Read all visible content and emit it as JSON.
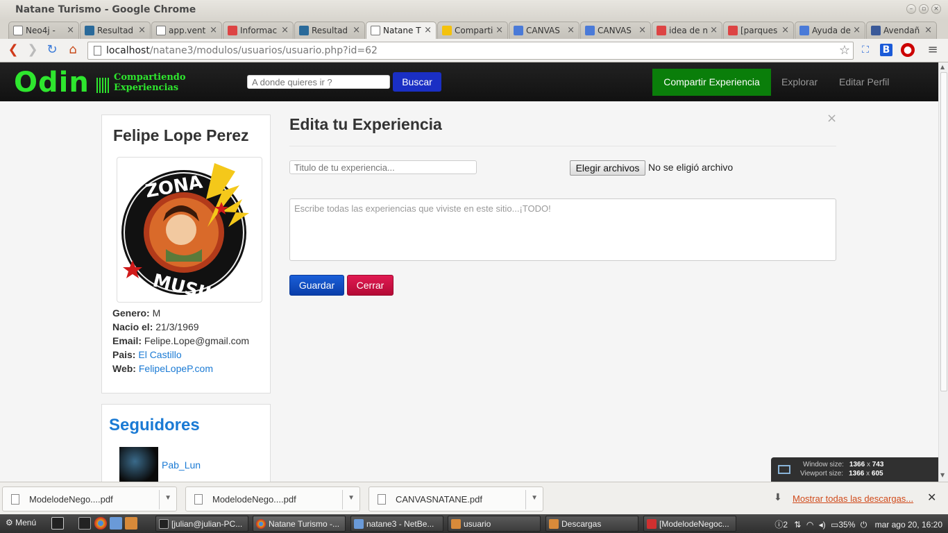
{
  "window": {
    "title": "Natane Turismo - Google Chrome"
  },
  "tabs": [
    {
      "label": "Neo4j - ",
      "icon": "doc-icon",
      "color": "#ffffff"
    },
    {
      "label": "Resultad",
      "icon": "bitnami-icon",
      "color": "#2a6a9a"
    },
    {
      "label": "app.vent",
      "icon": "doc-icon",
      "color": "#ffffff"
    },
    {
      "label": "Informac",
      "icon": "gmail-icon",
      "color": "#d44"
    },
    {
      "label": "Resultad",
      "icon": "bitnami-icon",
      "color": "#2a6a9a"
    },
    {
      "label": "Natane T",
      "icon": "doc-icon",
      "color": "#ffffff",
      "active": true
    },
    {
      "label": "Comparti",
      "icon": "drive-icon",
      "color": "#f4c20d"
    },
    {
      "label": "CANVAS",
      "icon": "docs-icon",
      "color": "#4a7ad8"
    },
    {
      "label": "CANVAS",
      "icon": "docs-icon",
      "color": "#4a7ad8"
    },
    {
      "label": "idea de n",
      "icon": "gmail-icon",
      "color": "#d44"
    },
    {
      "label": "[parques",
      "icon": "gmail-icon",
      "color": "#d44"
    },
    {
      "label": "Ayuda de",
      "icon": "google-icon",
      "color": "#4a7ad8"
    },
    {
      "label": "Avendañ",
      "icon": "facebook-icon",
      "color": "#3b5998"
    }
  ],
  "address": {
    "host": "localhost",
    "path": "/natane3/modulos/usuarios/usuario.php?id=62"
  },
  "site": {
    "brand": "Odin",
    "brand_sub_1": "Compartiendo",
    "brand_sub_2": "Experiencias",
    "search_placeholder": "A donde quieres ir ?",
    "search_button": "Buscar",
    "nav_share": "Compartir Experiencia",
    "nav_explore": "Explorar",
    "nav_edit": "Editar Perfil"
  },
  "profile": {
    "name": "Felipe Lope Perez",
    "avatar_text_top": "ZONA",
    "avatar_text_bottom": "MUSIK",
    "gender_label": "Genero:",
    "gender": "M",
    "born_label": "Nacio el:",
    "born": "21/3/1969",
    "email_label": "Email:",
    "email": "Felipe.Lope@gmail.com",
    "country_label": "Pais:",
    "country": "El Castillo",
    "web_label": "Web:",
    "web": "FelipeLopeP.com"
  },
  "followers": {
    "title": "Seguidores",
    "items": [
      {
        "name": "Pab_Lun"
      }
    ]
  },
  "edit": {
    "title": "Edita tu Experiencia",
    "close": "×",
    "title_placeholder": "Titulo de tu experiencia...",
    "file_button": "Elegir archivos",
    "file_status": "No se eligió archivo",
    "text_placeholder": "Escribe todas las experiencias que viviste en este sitio...¡TODO!",
    "save": "Guardar",
    "cancel": "Cerrar"
  },
  "winsize": {
    "window_label": "Window size:",
    "window_w": "1366",
    "window_h": "743",
    "viewport_label": "Viewport size:",
    "viewport_w": "1366",
    "viewport_h": "605",
    "x": "x"
  },
  "downloads": {
    "items": [
      "ModelodeNego....pdf",
      "ModelodeNego....pdf",
      "CANVASNATANE.pdf"
    ],
    "show_all": "Mostrar todas las descargas..."
  },
  "taskbar": {
    "menu": "Menú",
    "windows": [
      "[julian@julian-PC...",
      "Natane Turismo -...",
      "natane3 - NetBe...",
      "usuario",
      "Descargas",
      "[ModelodeNegoc..."
    ],
    "notif_count": "2",
    "battery": "35%",
    "clock": "mar ago 20, 16:20"
  }
}
